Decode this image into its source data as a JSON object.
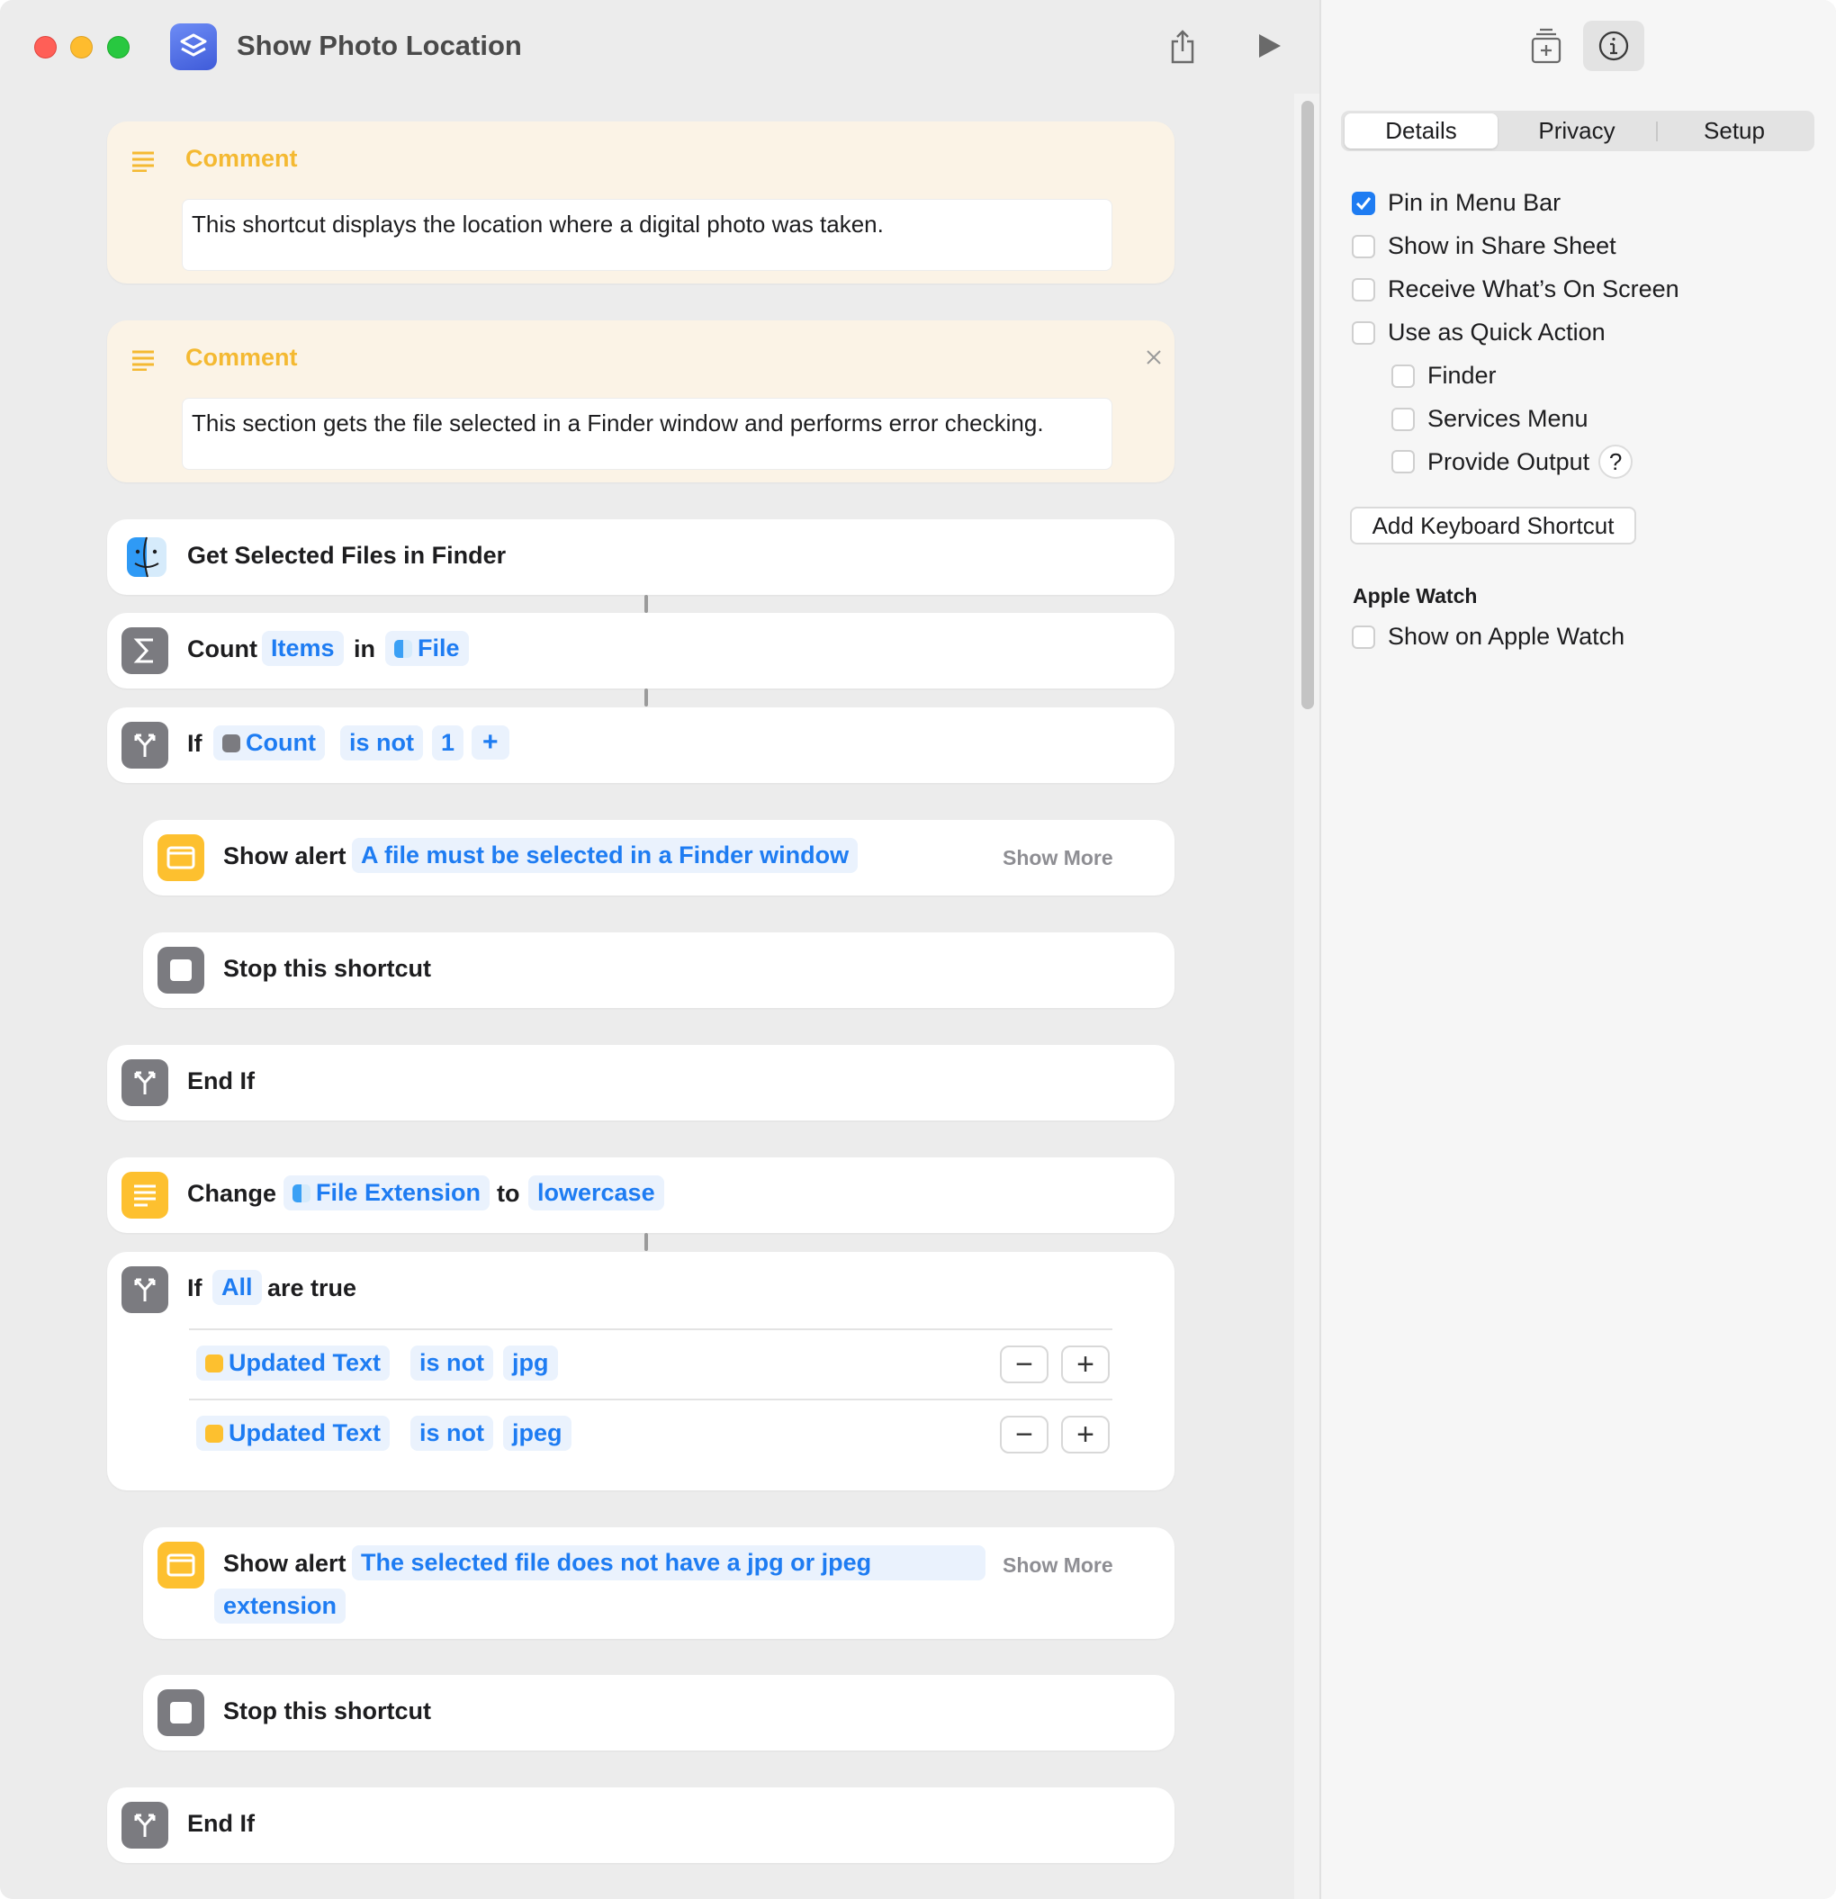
{
  "window": {
    "title": "Show Photo Location"
  },
  "toolbar": {
    "share_icon": "share-icon",
    "run_icon": "play-icon",
    "library_icon": "add-action-icon",
    "info_icon": "info-icon"
  },
  "actions": {
    "comment1": {
      "label": "Comment",
      "text": "This shortcut displays the location where a digital photo was taken."
    },
    "comment2": {
      "label": "Comment",
      "text": "This section gets the file selected in a Finder window and performs error checking."
    },
    "get_files": {
      "label": "Get Selected Files in Finder"
    },
    "count": {
      "label": "Count",
      "items_token": "Items",
      "in_label": "in",
      "file_token": "File"
    },
    "if1": {
      "if_label": "If",
      "count_token": "Count",
      "op_token": "is not",
      "value_token": "1",
      "add_token": "+"
    },
    "alert1": {
      "label": "Show alert",
      "message": "A file must be selected in a Finder window",
      "show_more": "Show More"
    },
    "stop1": {
      "label": "Stop this shortcut"
    },
    "endif1": {
      "label": "End If"
    },
    "change": {
      "label": "Change",
      "ext_token": "File Extension",
      "to_label": "to",
      "case_token": "lowercase"
    },
    "if2": {
      "if_label": "If",
      "all_token": "All",
      "are_true": "are true",
      "conditions": [
        {
          "var": "Updated Text",
          "op": "is not",
          "value": "jpg"
        },
        {
          "var": "Updated Text",
          "op": "is not",
          "value": "jpeg"
        }
      ],
      "minus": "−",
      "plus": "+"
    },
    "alert2": {
      "label": "Show alert",
      "message_line1": "The selected file does not have a jpg or jpeg",
      "message_line2": "extension",
      "show_more": "Show More"
    },
    "stop2": {
      "label": "Stop this shortcut"
    },
    "endif2": {
      "label": "End If"
    }
  },
  "sidebar": {
    "tabs": [
      "Details",
      "Privacy",
      "Setup"
    ],
    "active_tab": "Details",
    "options": [
      {
        "label": "Pin in Menu Bar",
        "checked": true
      },
      {
        "label": "Show in Share Sheet",
        "checked": false
      },
      {
        "label": "Receive What’s On Screen",
        "checked": false
      },
      {
        "label": "Use as Quick Action",
        "checked": false
      }
    ],
    "quick_action_options": [
      {
        "label": "Finder",
        "checked": false
      },
      {
        "label": "Services Menu",
        "checked": false
      },
      {
        "label": "Provide Output",
        "checked": false
      }
    ],
    "help_label": "?",
    "keyboard_button": "Add Keyboard Shortcut",
    "apple_watch_heading": "Apple Watch",
    "apple_watch_option": {
      "label": "Show on Apple Watch",
      "checked": false
    }
  },
  "colors": {
    "accent": "#1e7cf2",
    "comment_bg": "#fbf3e6",
    "comment_label": "#f4b932"
  }
}
